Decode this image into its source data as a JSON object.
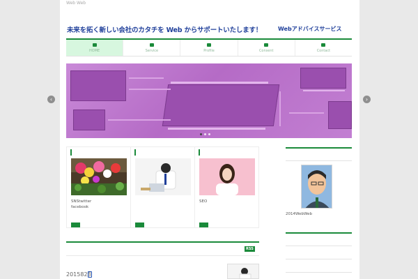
{
  "header": {
    "site_name": "Web Web",
    "tagline": "未来を拓く新しい会社のカタチを Web からサポートいたします！",
    "site_sub": "Webアドバイスサービス"
  },
  "nav": {
    "items": [
      {
        "label": "HOME",
        "icon": "home-icon"
      },
      {
        "label": "Service",
        "icon": "service-icon"
      },
      {
        "label": "Profile",
        "icon": "profile-icon"
      },
      {
        "label": "Consent",
        "icon": "consent-icon"
      },
      {
        "label": "Contact",
        "icon": "contact-icon"
      }
    ]
  },
  "slider": {
    "prev_label": "‹",
    "next_label": "›"
  },
  "cards": [
    {
      "text": "SNStwitter\nfacebook"
    },
    {
      "text": ""
    },
    {
      "text": "SEO"
    }
  ],
  "sidebar": {
    "caption": "2014WebWeb"
  },
  "news": {
    "rss_label": "RSS",
    "date": "2015828"
  },
  "colors": {
    "accent_green": "#1a8a3a",
    "title_blue": "#1f3f9a",
    "slider_purple": "#c27fd2"
  }
}
